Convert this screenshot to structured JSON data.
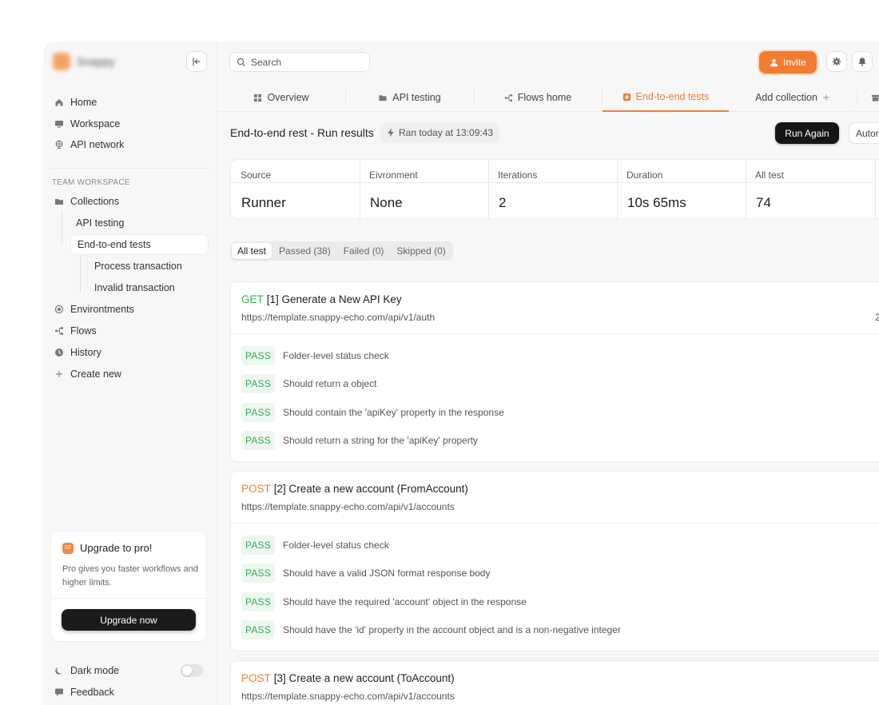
{
  "sidebar": {
    "brand_name": "Snappy",
    "nav": [
      {
        "label": "Home",
        "icon": "home-icon"
      },
      {
        "label": "Workspace",
        "icon": "monitor-icon"
      },
      {
        "label": "API network",
        "icon": "globe-icon"
      }
    ],
    "section_label": "TEAM WORKSPACE",
    "collections_label": "Collections",
    "tree": [
      {
        "label": "API testing"
      },
      {
        "label": "End-to-end tests",
        "active": true
      },
      {
        "label": "Process transaction"
      },
      {
        "label": "Invalid transaction"
      }
    ],
    "lower_nav": [
      {
        "label": "Environtments",
        "icon": "target-icon"
      },
      {
        "label": "Flows",
        "icon": "flow-icon"
      },
      {
        "label": "History",
        "icon": "clock-icon"
      },
      {
        "label": "Create new",
        "icon": "plus-icon"
      }
    ],
    "upgrade": {
      "badge": "02",
      "title": "Upgrade to pro!",
      "description": "Pro gives you faster workflows and higher limits.",
      "button": "Upgrade now"
    },
    "dark_mode_label": "Dark mode",
    "dark_mode_on": false,
    "feedback_label": "Feedback"
  },
  "topbar": {
    "search_placeholder": "Search",
    "invite_label": "Invite"
  },
  "tabs": [
    {
      "label": "Overview",
      "icon": "grid-icon"
    },
    {
      "label": "API testing",
      "icon": "folder-icon"
    },
    {
      "label": "Flows home",
      "icon": "flow-icon"
    },
    {
      "label": "End-to-end tests",
      "icon": "square-icon",
      "active": true
    },
    {
      "label": "Add collection",
      "icon": "plus-icon"
    }
  ],
  "run": {
    "title": "End-to-end rest - Run results",
    "ran_at": "Ran today at 13:09:43",
    "run_again_label": "Run Again",
    "auto_label": "Autor"
  },
  "stats": [
    {
      "label": "Source",
      "value": "Runner"
    },
    {
      "label": "Eivronment",
      "value": "None"
    },
    {
      "label": "Iterations",
      "value": "2"
    },
    {
      "label": "Duration",
      "value": "10s 65ms"
    },
    {
      "label": "All test",
      "value": "74"
    }
  ],
  "filters": [
    {
      "label": "All test",
      "active": true
    },
    {
      "label": "Passed (38)"
    },
    {
      "label": "Failed (0)"
    },
    {
      "label": "Skipped (0)"
    }
  ],
  "requests": [
    {
      "method": "GET",
      "title": "[1] Generate a New API Key",
      "url": "https://template.snappy-echo.com/api/v1/auth",
      "extra": "2",
      "tests": [
        {
          "status": "PASS",
          "name": "Folder-level status check"
        },
        {
          "status": "PASS",
          "name": "Should return a object"
        },
        {
          "status": "PASS",
          "name": "Should contain the 'apiKey' property in the response"
        },
        {
          "status": "PASS",
          "name": "Should return a string for the 'apiKey' property"
        }
      ]
    },
    {
      "method": "POST",
      "title": "[2] Create a new account (FromAccount)",
      "url": "https://template.snappy-echo.com/api/v1/accounts",
      "tests": [
        {
          "status": "PASS",
          "name": "Folder-level status check"
        },
        {
          "status": "PASS",
          "name": "Should have a valid JSON format response body"
        },
        {
          "status": "PASS",
          "name": "Should have the required 'account' object in the response"
        },
        {
          "status": "PASS",
          "name": "Should have the 'id' property in the account object and is a non-negative integer"
        }
      ]
    },
    {
      "method": "POST",
      "title": "[3] Create a new account (ToAccount)",
      "url": "https://template.snappy-echo.com/api/v1/accounts",
      "tests": []
    }
  ],
  "colors": {
    "accent": "#f27d32",
    "pass_text": "#36a95c",
    "pass_bg": "#edf7ef",
    "get": "#2fb65c",
    "post": "#f27d32"
  }
}
